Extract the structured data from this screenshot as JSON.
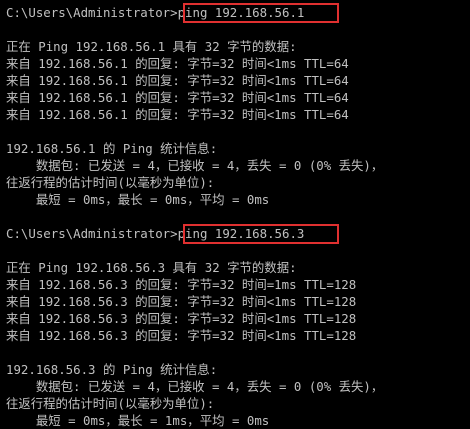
{
  "accent": {
    "box_color": "#e03030",
    "background": "#000000",
    "text_color": "#c0c0c0"
  },
  "session1": {
    "prompt": "C:\\Users\\Administrator>",
    "command": "ping 192.168.56.1",
    "header": "正在 Ping 192.168.56.1 具有 32 字节的数据:",
    "replies": [
      "来自 192.168.56.1 的回复: 字节=32 时间<1ms TTL=64",
      "来自 192.168.56.1 的回复: 字节=32 时间<1ms TTL=64",
      "来自 192.168.56.1 的回复: 字节=32 时间<1ms TTL=64",
      "来自 192.168.56.1 的回复: 字节=32 时间<1ms TTL=64"
    ],
    "stats_title": "192.168.56.1 的 Ping 统计信息:",
    "stats_packets": "    数据包: 已发送 = 4，已接收 = 4，丢失 = 0 (0% 丢失)，",
    "rtt_title": "往返行程的估计时间(以毫秒为单位):",
    "rtt_values": "    最短 = 0ms，最长 = 0ms，平均 = 0ms"
  },
  "session2": {
    "prompt": "C:\\Users\\Administrator>",
    "command": "ping 192.168.56.3",
    "header": "正在 Ping 192.168.56.3 具有 32 字节的数据:",
    "replies": [
      "来自 192.168.56.3 的回复: 字节=32 时间=1ms TTL=128",
      "来自 192.168.56.3 的回复: 字节=32 时间<1ms TTL=128",
      "来自 192.168.56.3 的回复: 字节=32 时间<1ms TTL=128",
      "来自 192.168.56.3 的回复: 字节=32 时间<1ms TTL=128"
    ],
    "stats_title": "192.168.56.3 的 Ping 统计信息:",
    "stats_packets": "    数据包: 已发送 = 4，已接收 = 4，丢失 = 0 (0% 丢失)，",
    "rtt_title": "往返行程的估计时间(以毫秒为单位):",
    "rtt_values": "    最短 = 0ms，最长 = 1ms，平均 = 0ms"
  }
}
